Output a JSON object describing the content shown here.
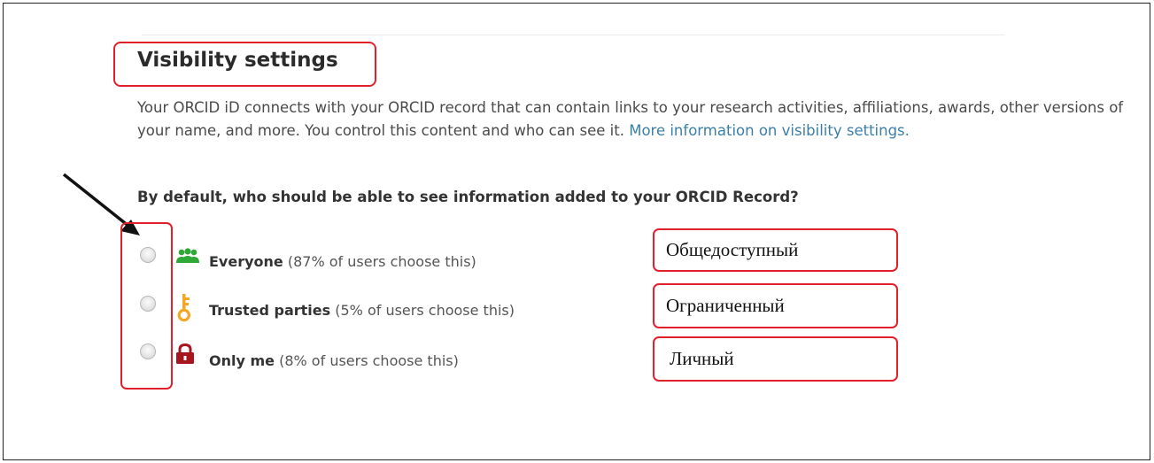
{
  "header": {
    "title": "Visibility settings"
  },
  "description": {
    "text": "Your ORCID iD connects with your ORCID record that can contain links to your research activities, affiliations, awards, other versions of your name, and more. You control this content and who can see it. ",
    "link": "More information on visibility settings."
  },
  "question": "By default, who should be able to see information added to your ORCID Record?",
  "options": [
    {
      "label": "Everyone",
      "note": "(87% of users choose this)",
      "icon": "users-icon",
      "color": "#2ea836",
      "selected": false
    },
    {
      "label": "Trusted parties",
      "note": "(5% of users choose this)",
      "icon": "key-icon",
      "color": "#f5a623",
      "selected": false
    },
    {
      "label": "Only me",
      "note": "(8% of users choose this)",
      "icon": "lock-icon",
      "color": "#a8161d",
      "selected": false
    }
  ],
  "annotations": [
    {
      "text": "Общедоступный"
    },
    {
      "text": "Ограниченный"
    },
    {
      "text": "Личный"
    }
  ],
  "colors": {
    "highlight_border": "#e0212b",
    "link": "#3b7fa8"
  }
}
